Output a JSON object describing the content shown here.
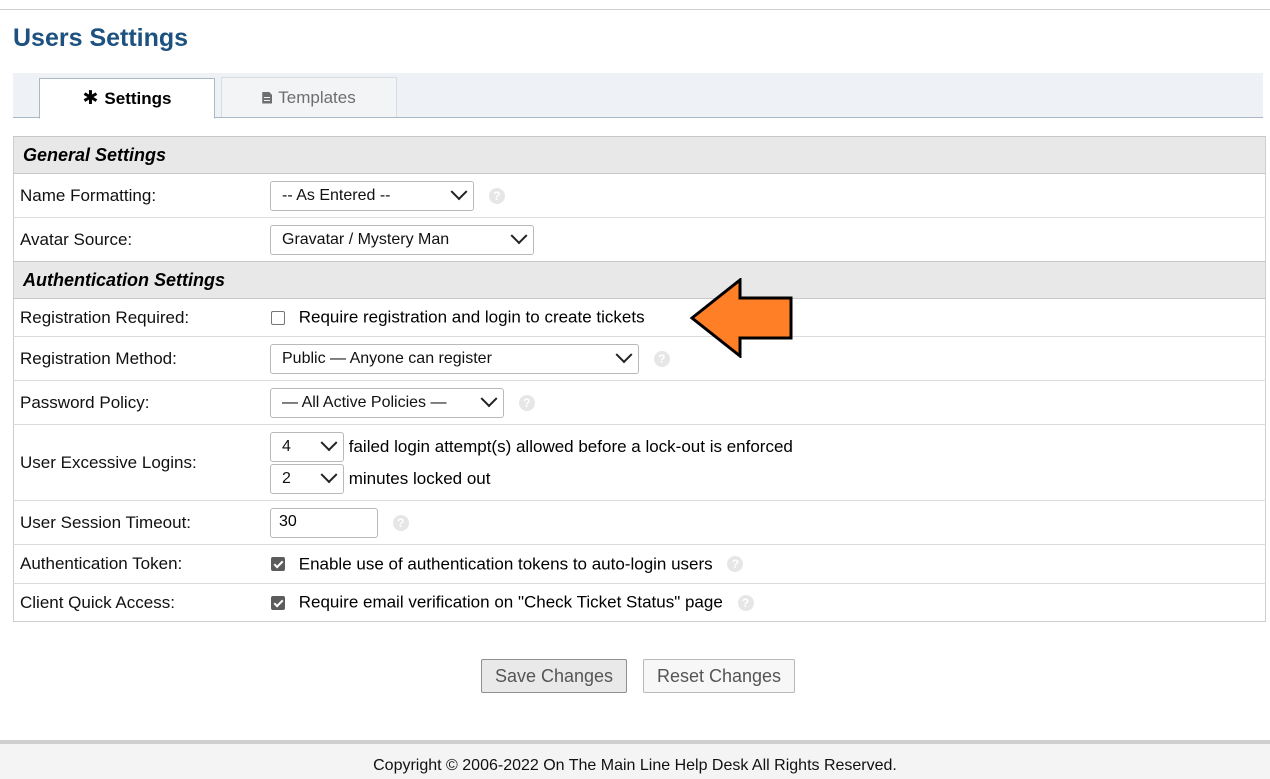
{
  "page": {
    "title": "Users Settings"
  },
  "tabs": [
    {
      "label": "Settings",
      "icon": "asterisk-icon",
      "active": true
    },
    {
      "label": "Templates",
      "icon": "file-icon",
      "active": false
    }
  ],
  "general": {
    "heading": "General Settings",
    "name_formatting": {
      "label": "Name Formatting:",
      "value": "-- As Entered --"
    },
    "avatar_source": {
      "label": "Avatar Source:",
      "value": "Gravatar / Mystery Man"
    }
  },
  "auth": {
    "heading": "Authentication Settings",
    "registration_required": {
      "label": "Registration Required:",
      "text": "Require registration and login to create tickets",
      "checked": false
    },
    "registration_method": {
      "label": "Registration Method:",
      "value": "Public — Anyone can register"
    },
    "password_policy": {
      "label": "Password Policy:",
      "value": "— All Active Policies —"
    },
    "excessive_logins": {
      "label": "User Excessive Logins:",
      "attempts": "4",
      "attempts_text": "failed login attempt(s) allowed before a lock-out is enforced",
      "minutes": "2",
      "minutes_text": "minutes locked out"
    },
    "session_timeout": {
      "label": "User Session Timeout:",
      "value": "30"
    },
    "auth_token": {
      "label": "Authentication Token:",
      "text": "Enable use of authentication tokens to auto-login users",
      "checked": true
    },
    "quick_access": {
      "label": "Client Quick Access:",
      "text": "Require email verification on \"Check Ticket Status\" page",
      "checked": true
    }
  },
  "actions": {
    "save": "Save Changes",
    "reset": "Reset Changes"
  },
  "footer": {
    "copyright": "Copyright © 2006-2022 On The Main Line Help Desk All Rights Reserved."
  },
  "colors": {
    "title": "#1c5180",
    "annotation_arrow": "#ff7f27"
  }
}
